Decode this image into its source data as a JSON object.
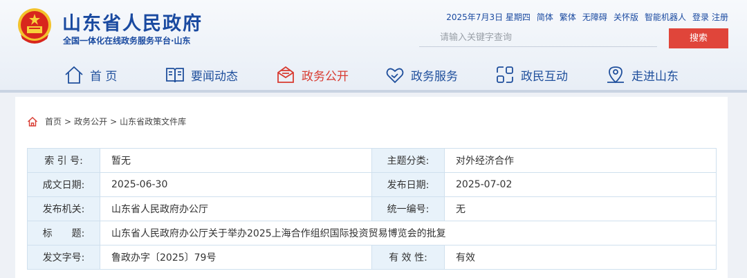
{
  "site": {
    "title": "山东省人民政府",
    "subtitle": "全国一体化在线政务服务平台·山东"
  },
  "top_links": {
    "date": "2025年7月3日 星期四",
    "simplified": "简体",
    "traditional": "繁体",
    "accessible": "无障碍",
    "care": "关怀版",
    "robot": "智能机器人",
    "login": "登录",
    "register": "注册"
  },
  "search": {
    "placeholder": "请输入关键字查询",
    "button": "搜索"
  },
  "nav": {
    "home": "首 页",
    "news": "要闻动态",
    "gov_open": "政务公开",
    "services": "政务服务",
    "interaction": "政民互动",
    "explore": "走进山东"
  },
  "breadcrumb": {
    "home": "首页",
    "sep": ">",
    "l1": "政务公开",
    "l2": "山东省政策文件库"
  },
  "info": {
    "index_label": "索 引 号:",
    "index_value": "暂无",
    "topic_label": "主题分类:",
    "topic_value": "对外经济合作",
    "created_label": "成文日期:",
    "created_value": "2025-06-30",
    "published_label": "发布日期:",
    "published_value": "2025-07-02",
    "issuer_label": "发布机关:",
    "issuer_value": "山东省人民政府办公厅",
    "serial_label": "统一编号:",
    "serial_value": "无",
    "title_label": "标　　题:",
    "title_value": "山东省人民政府办公厅关于举办2025上海合作组织国际投资贸易博览会的批复",
    "docno_label": "发文字号:",
    "docno_value": "鲁政办字〔2025〕79号",
    "validity_label": "有 效 性:",
    "validity_value": "有效"
  },
  "colors": {
    "brand_blue": "#1a4aa0",
    "accent_red": "#e0453a",
    "label_bg": "#e8f2fa"
  },
  "icons": [
    "national-emblem-icon",
    "home-icon",
    "book-icon",
    "envelope-icon",
    "heart-hand-icon",
    "interaction-icon",
    "location-person-icon"
  ]
}
